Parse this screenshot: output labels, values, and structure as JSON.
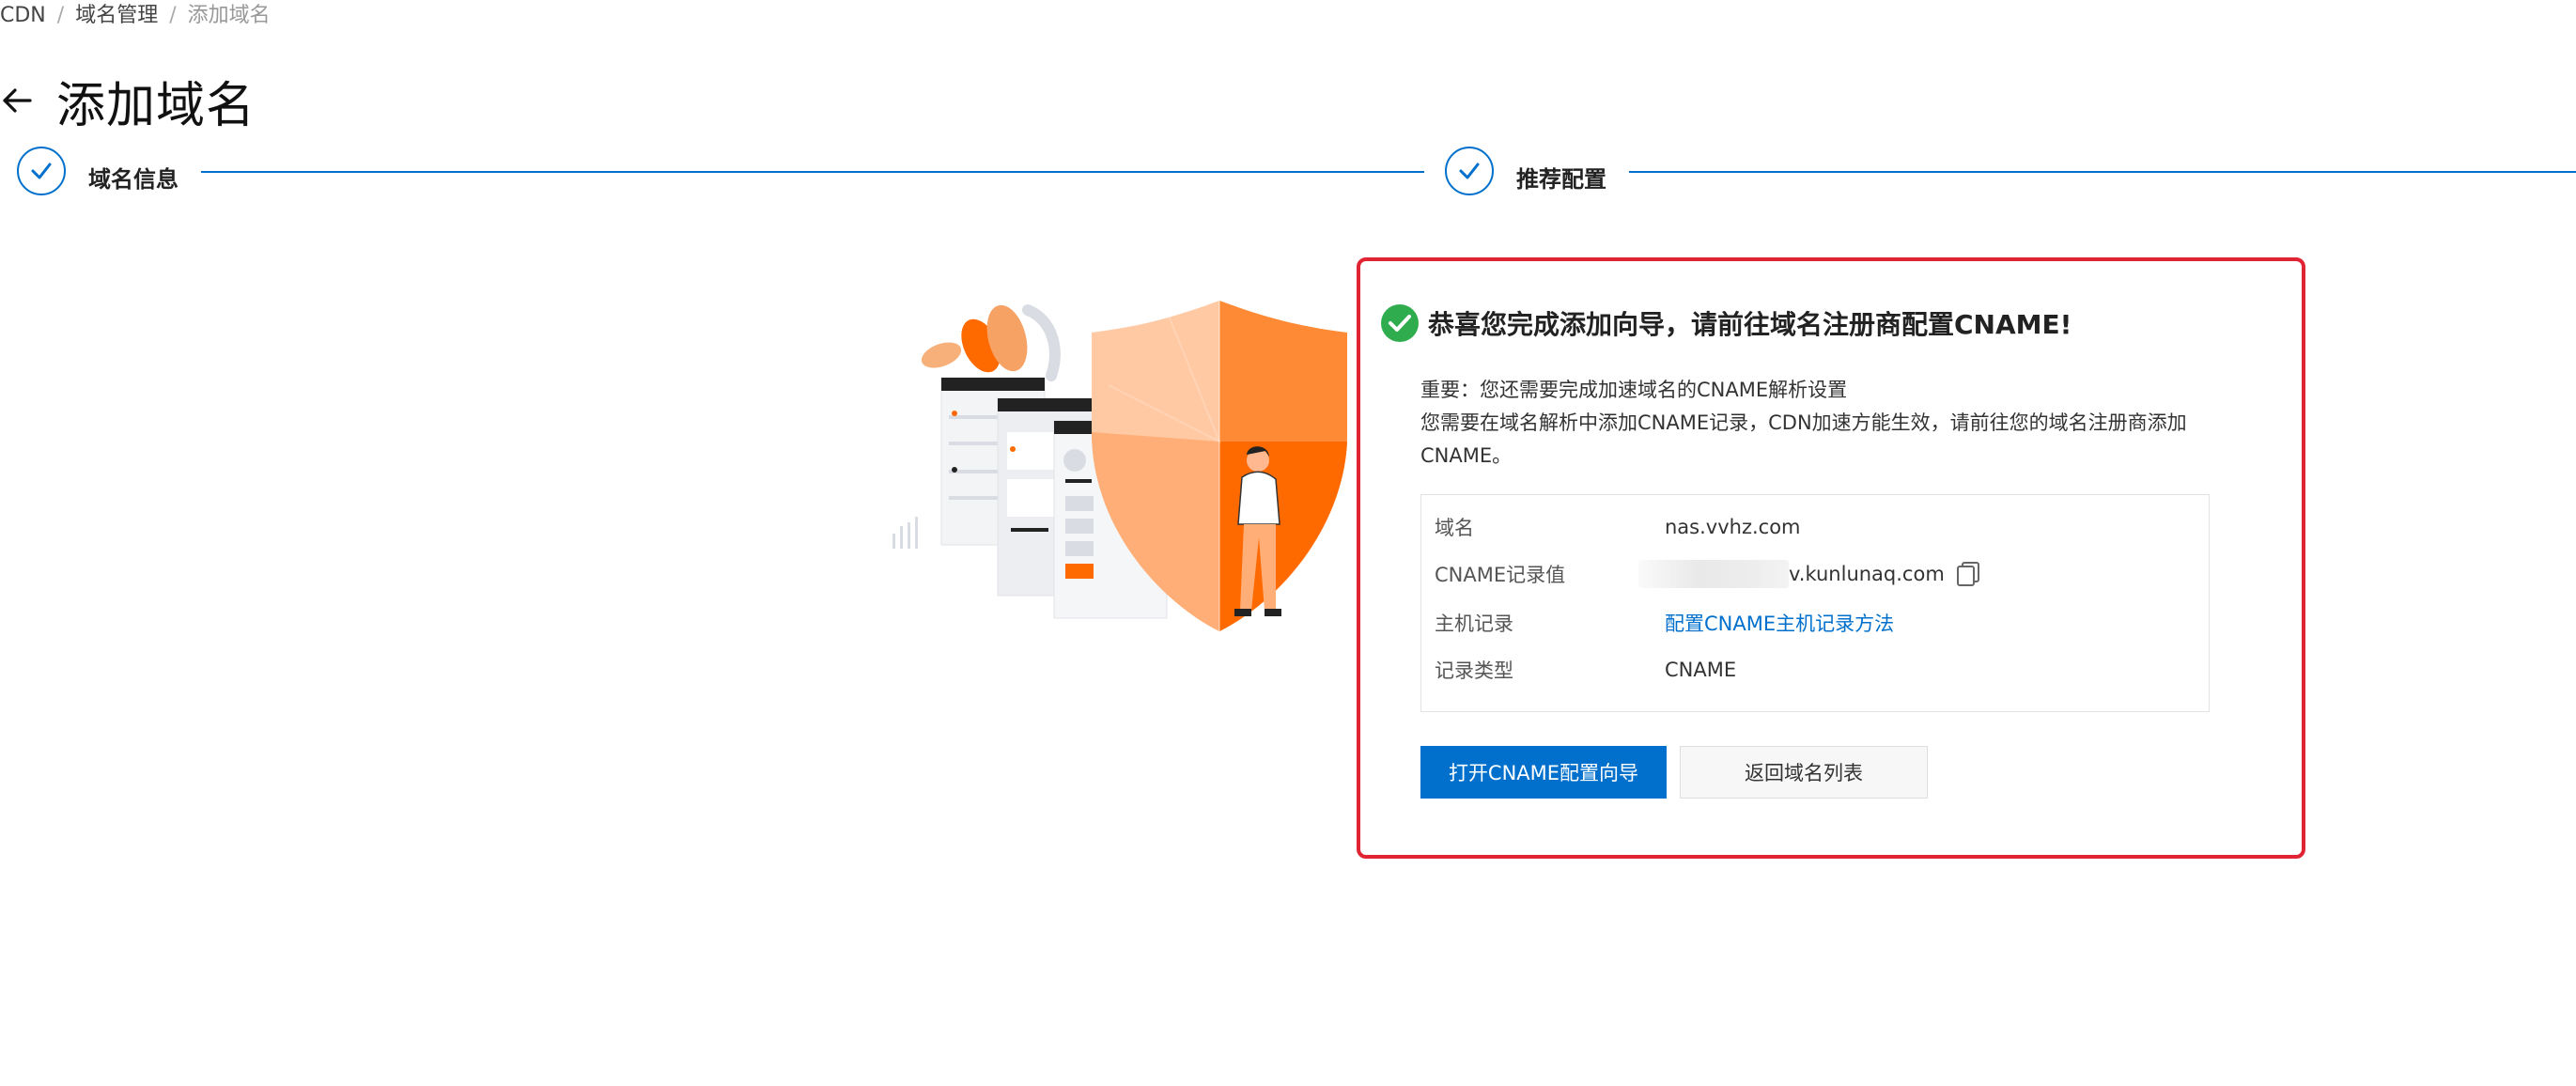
{
  "breadcrumb": {
    "items": [
      "CDN",
      "域名管理",
      "添加域名"
    ],
    "separator": "/"
  },
  "header": {
    "back_icon": "arrow-left-icon",
    "title": "添加域名"
  },
  "steps": [
    {
      "label": "域名信息",
      "status": "done",
      "icon": "check-icon"
    },
    {
      "label": "推荐配置",
      "status": "done",
      "icon": "check-icon"
    }
  ],
  "result": {
    "icon": "check-circle-icon",
    "title": "恭喜您完成添加向导，请前往域名注册商配置CNAME!",
    "notice_line1": "重要：您还需要完成加速域名的CNAME解析设置",
    "notice_line2": "您需要在域名解析中添加CNAME记录，CDN加速方能生效，请前往您的域名注册商添加CNAME。",
    "rows": [
      {
        "key": "域名",
        "value": "nas.vvhz.com"
      },
      {
        "key": "CNAME记录值",
        "value": "v.kunlunaq.com"
      },
      {
        "key": "主机记录",
        "value": "配置CNAME主机记录方法"
      },
      {
        "key": "记录类型",
        "value": "CNAME"
      }
    ],
    "primary_button": "打开CNAME配置向导",
    "secondary_button": "返回域名列表"
  },
  "colors": {
    "primary": "#0070cc",
    "success": "#2fad4e",
    "highlight_border": "#e02433",
    "orange": "#ff6a00"
  }
}
